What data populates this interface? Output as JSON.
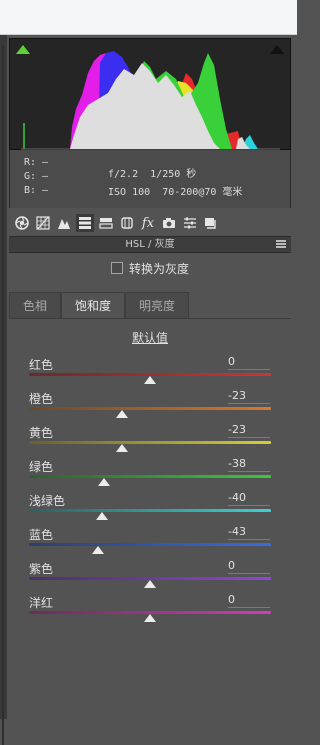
{
  "panel": {
    "readout": {
      "r_label": "R:",
      "r_value": "—",
      "g_label": "G:",
      "g_value": "—",
      "b_label": "B:",
      "b_value": "—"
    },
    "camera": {
      "aperture": "f/2.2",
      "shutter": "1/250 秒",
      "iso": "ISO 100",
      "lens": "70-200@70 毫米"
    },
    "section_title": "HSL / 灰度",
    "convert_gray_label": "转换为灰度",
    "convert_gray_checked": false,
    "tabs": [
      {
        "label": "色相",
        "active": false
      },
      {
        "label": "饱和度",
        "active": true
      },
      {
        "label": "明亮度",
        "active": false
      }
    ],
    "default_label": "默认值",
    "sliders": [
      {
        "label": "红色",
        "value": "0",
        "num": 0,
        "gradient": [
          "#6a2a2a",
          "#c9363a"
        ]
      },
      {
        "label": "橙色",
        "value": "-23",
        "num": -23,
        "gradient": [
          "#6a4a2a",
          "#d87a2a"
        ]
      },
      {
        "label": "黄色",
        "value": "-23",
        "num": -23,
        "gradient": [
          "#66612e",
          "#d8cf32"
        ]
      },
      {
        "label": "绿色",
        "value": "-38",
        "num": -38,
        "gradient": [
          "#2f6030",
          "#3cc93e"
        ]
      },
      {
        "label": "浅绿色",
        "value": "-40",
        "num": -40,
        "gradient": [
          "#2e6060",
          "#3ad3cf"
        ]
      },
      {
        "label": "蓝色",
        "value": "-43",
        "num": -43,
        "gradient": [
          "#2e3f6a",
          "#3a6be0"
        ]
      },
      {
        "label": "紫色",
        "value": "0",
        "num": 0,
        "gradient": [
          "#4d2e6a",
          "#9146d6"
        ]
      },
      {
        "label": "洋红",
        "value": "0",
        "num": 0,
        "gradient": [
          "#6a2e5a",
          "#d43ab6"
        ]
      }
    ]
  },
  "icons": [
    "basic-aperture-icon",
    "tone-curve-grid-icon",
    "detail-triangle-icon",
    "hsl-icon",
    "split-tone-icon",
    "lens-icon",
    "fx-icon",
    "camera-calibration-icon",
    "presets-sliders-icon",
    "snapshots-icon"
  ]
}
